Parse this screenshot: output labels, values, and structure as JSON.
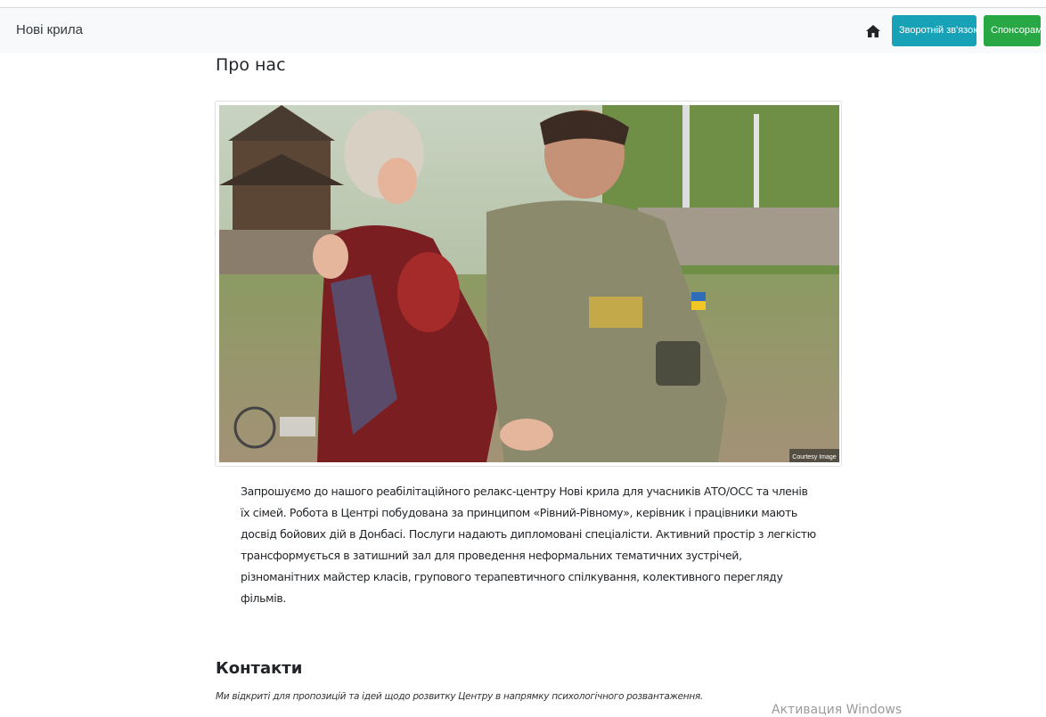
{
  "navbar": {
    "brand": "Нові крила",
    "home_icon": "home-icon",
    "feedback_label": "Зворотній зв'язок",
    "sponsors_label": "Спонсорам",
    "colors": {
      "feedback": "#17a2b8",
      "sponsors": "#28a745"
    }
  },
  "about": {
    "title": "Про нас",
    "image_caption": "Courtesy Image",
    "text": "Запрошуємо до нашого реабілітаційного релакс-центру Нові крила для учасників АТО/ОСС та членів їх сімей. Робота в Центрі побудована за принципом «Рівний-Рівному», керівник і працівники мають досвід бойових дій в Донбасі. Послуги надають дипломовані спеціалісти. Активний простір з легкістю трансформується в затишний зал для проведення неформальних тематичних зустрічей, різноманітних майстер класів, групового терапевтичного спілкування, колективного перегляду фільмів."
  },
  "contacts": {
    "title": "Контакти",
    "subtitle": "Ми відкриті для пропозицій та ідей щодо розвитку Центру в напрямку психологічного розвантаження."
  },
  "os_watermark": "Активация Windows"
}
